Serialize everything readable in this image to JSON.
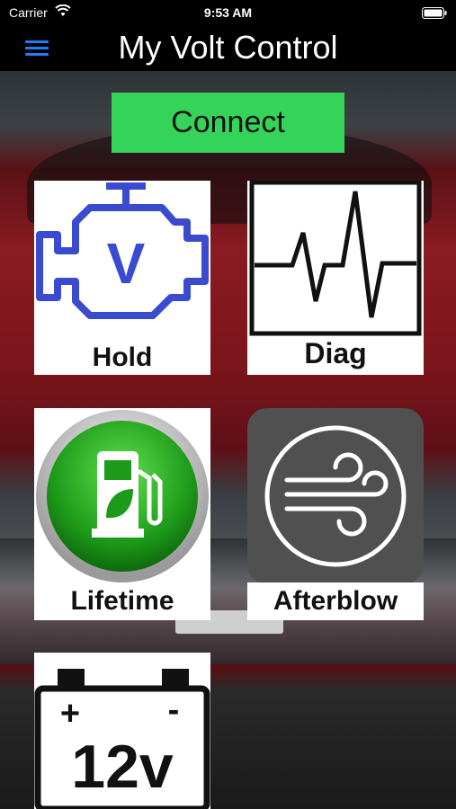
{
  "status_bar": {
    "carrier": "Carrier",
    "time": "9:53 AM"
  },
  "nav": {
    "title": "My Volt Control"
  },
  "connect_button": {
    "label": "Connect"
  },
  "tiles": [
    {
      "label": "Hold",
      "icon": "engine-v-icon"
    },
    {
      "label": "Diag",
      "icon": "pulse-wave-icon"
    },
    {
      "label": "Lifetime",
      "icon": "fuel-pump-leaf-icon"
    },
    {
      "label": "Afterblow",
      "icon": "wind-icon"
    },
    {
      "label": "",
      "icon": "battery-12v-icon",
      "icon_text": "12v",
      "plus": "+",
      "minus": "-"
    }
  ],
  "colors": {
    "accent": "#1f7dff",
    "connect": "#34d45a",
    "engine": "#3a4bd0"
  }
}
